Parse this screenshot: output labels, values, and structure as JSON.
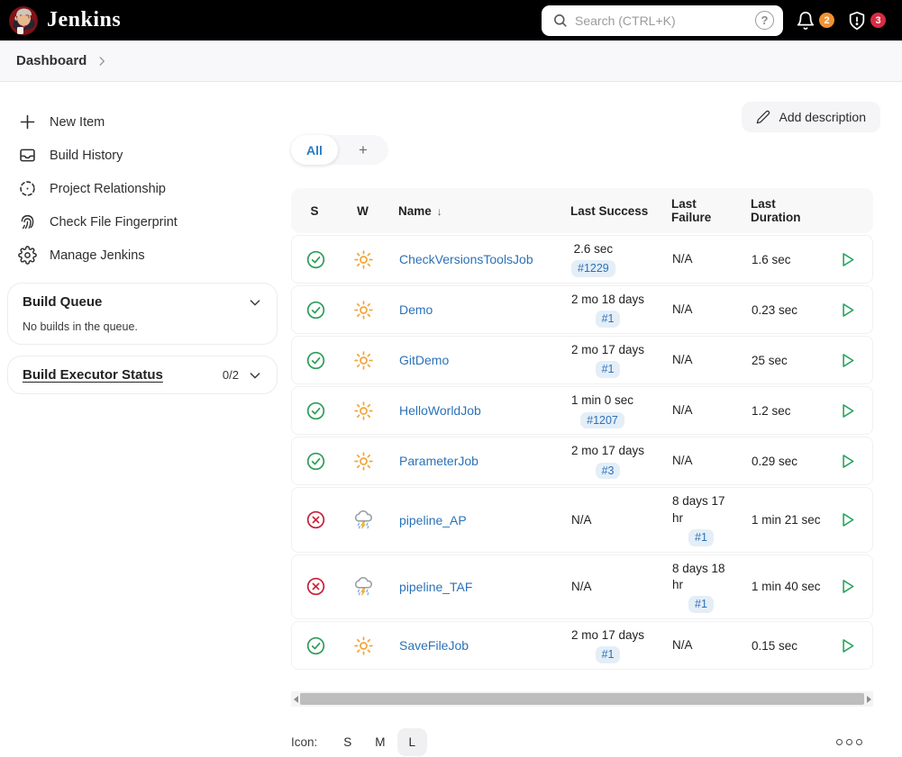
{
  "header": {
    "app_title": "Jenkins",
    "search": {
      "placeholder": "Search (CTRL+K)",
      "help_glyph": "?"
    },
    "notification_count": "2",
    "security_count": "3"
  },
  "breadcrumb": {
    "root": "Dashboard"
  },
  "sidebar": {
    "items": [
      {
        "label": "New Item",
        "icon": "plus-icon"
      },
      {
        "label": "Build History",
        "icon": "history-tray-icon"
      },
      {
        "label": "Project Relationship",
        "icon": "relationship-icon"
      },
      {
        "label": "Check File Fingerprint",
        "icon": "fingerprint-icon"
      },
      {
        "label": "Manage Jenkins",
        "icon": "gear-icon"
      }
    ],
    "build_queue": {
      "title": "Build Queue",
      "empty_text": "No builds in the queue."
    },
    "executor_status": {
      "title": "Build Executor Status",
      "count": "0/2"
    }
  },
  "main": {
    "add_description_label": "Add description",
    "tabs": {
      "active": "All",
      "add_glyph": "+"
    },
    "table": {
      "columns": [
        "S",
        "W",
        "Name",
        "Last Success",
        "Last Failure",
        "Last Duration"
      ],
      "sort_arrow": "↓",
      "rows": [
        {
          "status": "success",
          "weather": "sun",
          "name": "CheckVersionsToolsJob",
          "success_time": "2.6 sec",
          "success_badge": "#1229",
          "failure_time": "N/A",
          "failure_badge": "",
          "duration": "1.6 sec"
        },
        {
          "status": "success",
          "weather": "sun",
          "name": "Demo",
          "success_time": "2 mo 18 days",
          "success_badge": "#1",
          "failure_time": "N/A",
          "failure_badge": "",
          "duration": "0.23 sec"
        },
        {
          "status": "success",
          "weather": "sun",
          "name": "GitDemo",
          "success_time": "2 mo 17 days",
          "success_badge": "#1",
          "failure_time": "N/A",
          "failure_badge": "",
          "duration": "25 sec"
        },
        {
          "status": "success",
          "weather": "sun",
          "name": "HelloWorldJob",
          "success_time": "1 min 0 sec",
          "success_badge": "#1207",
          "failure_time": "N/A",
          "failure_badge": "",
          "duration": "1.2 sec"
        },
        {
          "status": "success",
          "weather": "sun",
          "name": "ParameterJob",
          "success_time": "2 mo 17 days",
          "success_badge": "#3",
          "failure_time": "N/A",
          "failure_badge": "",
          "duration": "0.29 sec"
        },
        {
          "status": "failure",
          "weather": "storm",
          "name": "pipeline_AP",
          "success_time": "N/A",
          "success_badge": "",
          "failure_time": "8 days 17 hr",
          "failure_badge": "#1",
          "duration": "1 min 21 sec"
        },
        {
          "status": "failure",
          "weather": "storm",
          "name": "pipeline_TAF",
          "success_time": "N/A",
          "success_badge": "",
          "failure_time": "8 days 18 hr",
          "failure_badge": "#1",
          "duration": "1 min 40 sec"
        },
        {
          "status": "success",
          "weather": "sun",
          "name": "SaveFileJob",
          "success_time": "2 mo 17 days",
          "success_badge": "#1",
          "failure_time": "N/A",
          "failure_badge": "",
          "duration": "0.15 sec"
        }
      ]
    },
    "footer": {
      "icon_label": "Icon:",
      "sizes": [
        "S",
        "M",
        "L"
      ],
      "active_size": "L"
    }
  },
  "colors": {
    "link_blue": "#2b72b8",
    "success_green": "#2e9e5b",
    "failure_red": "#c8213a",
    "sun_orange": "#f2a63b",
    "badge_orange": "#ef9235",
    "badge_red": "#d92b43"
  }
}
